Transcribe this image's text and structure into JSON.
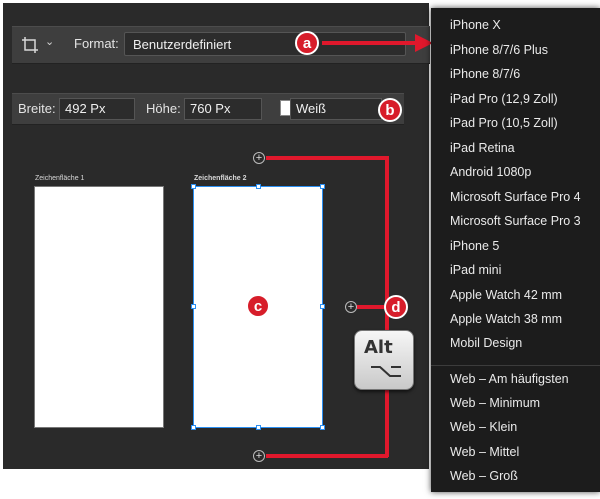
{
  "toolbar1": {
    "format_label": "Format:",
    "format_value": "Benutzerdefiniert"
  },
  "toolbar2": {
    "width_label": "Breite:",
    "width_value": "492 Px",
    "height_label": "Höhe:",
    "height_value": "760 Px",
    "swatch_color": "#ffffff",
    "color_name": "Weiß"
  },
  "artboards": [
    {
      "label": "Zeichenfläche 1"
    },
    {
      "label": "Zeichenfläche 2"
    }
  ],
  "annotations": {
    "a": "a",
    "b": "b",
    "c": "c",
    "d": "d"
  },
  "alt_key": {
    "label": "Alt",
    "icon": "option-key-icon"
  },
  "plus_symbol": "+",
  "dropdown": {
    "devices": [
      "iPhone X",
      "iPhone 8/7/6 Plus",
      "iPhone 8/7/6",
      "iPad Pro (12,9 Zoll)",
      "iPad Pro (10,5 Zoll)",
      "iPad Retina",
      "Android 1080p",
      "Microsoft Surface Pro 4",
      "Microsoft Surface Pro 3",
      "iPhone 5",
      "iPad mini",
      "Apple Watch 42 mm",
      "Apple Watch 38 mm",
      "Mobil Design"
    ],
    "web": [
      "Web – Am häufigsten",
      "Web – Minimum",
      "Web – Klein",
      "Web – Mittel",
      "Web – Groß"
    ]
  },
  "colors": {
    "annotation_red": "#e0182c",
    "selection_blue": "#2a8ff2",
    "panel_dark": "#2a2a2a"
  }
}
